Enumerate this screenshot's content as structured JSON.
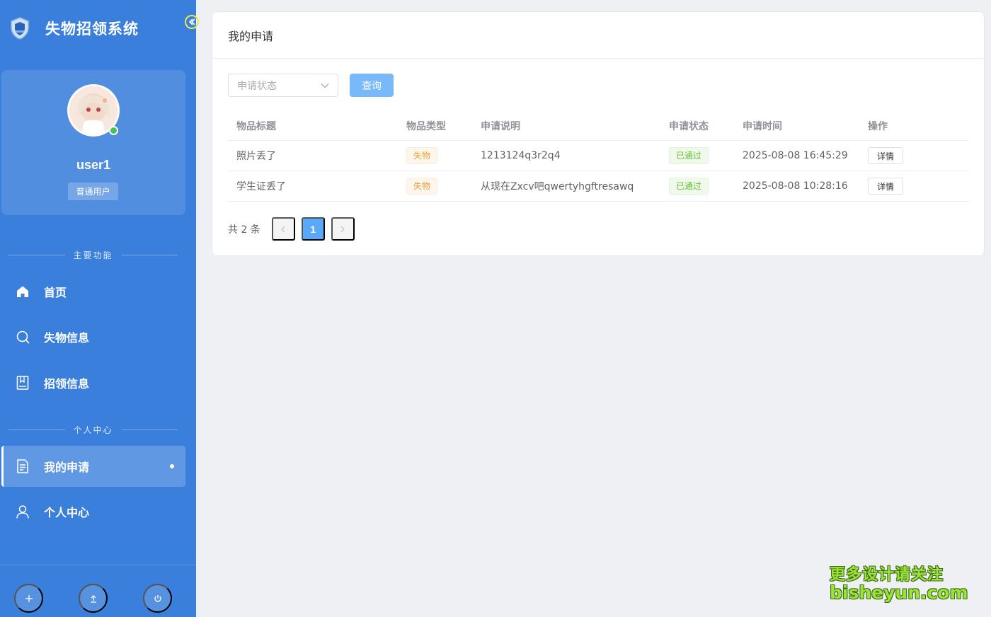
{
  "app": {
    "title": "失物招领系统"
  },
  "profile": {
    "username": "user1",
    "role": "普通用户",
    "online_color": "#44c35a"
  },
  "nav": {
    "section_main": "主要功能",
    "section_personal": "个人中心",
    "items": [
      {
        "label": "首页",
        "icon": "home-icon"
      },
      {
        "label": "失物信息",
        "icon": "search-icon"
      },
      {
        "label": "招领信息",
        "icon": "book-icon"
      },
      {
        "label": "我的申请",
        "icon": "document-icon",
        "active": true
      },
      {
        "label": "个人中心",
        "icon": "user-icon"
      }
    ]
  },
  "footer": {
    "buttons": [
      "plus-icon",
      "upload-icon",
      "power-icon"
    ]
  },
  "page": {
    "title": "我的申请"
  },
  "filter": {
    "status_placeholder": "申请状态",
    "query_label": "查询"
  },
  "table": {
    "headers": [
      "物品标题",
      "物品类型",
      "申请说明",
      "申请状态",
      "申请时间",
      "操作"
    ],
    "rows": [
      {
        "title": "照片丢了",
        "type": "失物",
        "desc": "1213124q3r2q4",
        "status": "已通过",
        "time": "2025-08-08 16:45:29",
        "action": "详情"
      },
      {
        "title": "学生证丢了",
        "type": "失物",
        "desc": "从现在Zxcv吧qwertyhgftresawq",
        "status": "已通过",
        "time": "2025-08-08 10:28:16",
        "action": "详情"
      }
    ]
  },
  "pagination": {
    "total_text": "共 2 条",
    "current_page": "1"
  },
  "watermark": {
    "line1": "更多设计请关注",
    "line2": "bisheyun.com"
  },
  "colors": {
    "sidebar": "#3a7fdc",
    "primary_light": "#79b8f9",
    "warning": "#e6a23c",
    "success": "#67c23a"
  }
}
